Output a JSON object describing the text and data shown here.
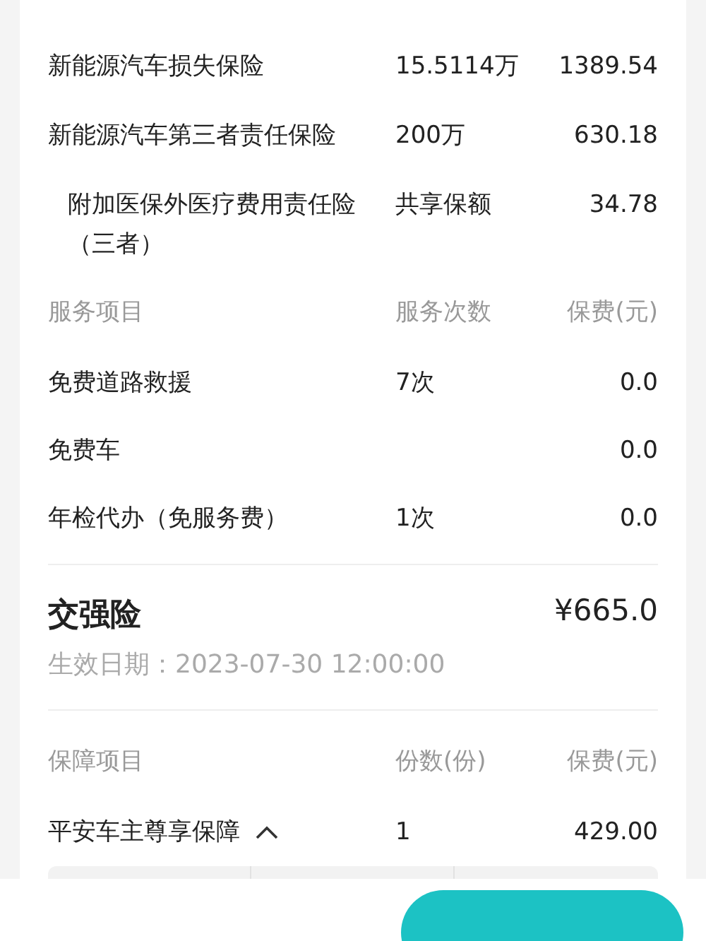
{
  "commercial": {
    "rows": [
      {
        "name": "新能源汽车损失保险",
        "amount": "15.5114万",
        "premium": "1389.54",
        "indent": false
      },
      {
        "name": "新能源汽车第三者责任保险",
        "amount": "200万",
        "premium": "630.18",
        "indent": false
      },
      {
        "name": "附加医保外医疗费用责任险（三者）",
        "amount": "共享保额",
        "premium": "34.78",
        "indent": true
      }
    ]
  },
  "services": {
    "header": [
      "服务项目",
      "服务次数",
      "保费(元)"
    ],
    "rows": [
      {
        "name": "免费道路救援",
        "count": "7次",
        "premium": "0.0"
      },
      {
        "name": "免费车",
        "premium": "0.0"
      },
      {
        "name": "年检代办（免服务费）",
        "count": "1次",
        "premium": "0.0"
      }
    ]
  },
  "compulsory": {
    "title": "交强险",
    "price": "¥665.0",
    "effective": "生效日期：2023-07-30 12:00:00"
  },
  "extras": {
    "header": [
      "保障项目",
      "份数(份)",
      "保费(元)"
    ],
    "rows": [
      {
        "name": "平安车主尊享保障",
        "count": "1",
        "premium": "429.00",
        "expanded": true
      }
    ]
  }
}
